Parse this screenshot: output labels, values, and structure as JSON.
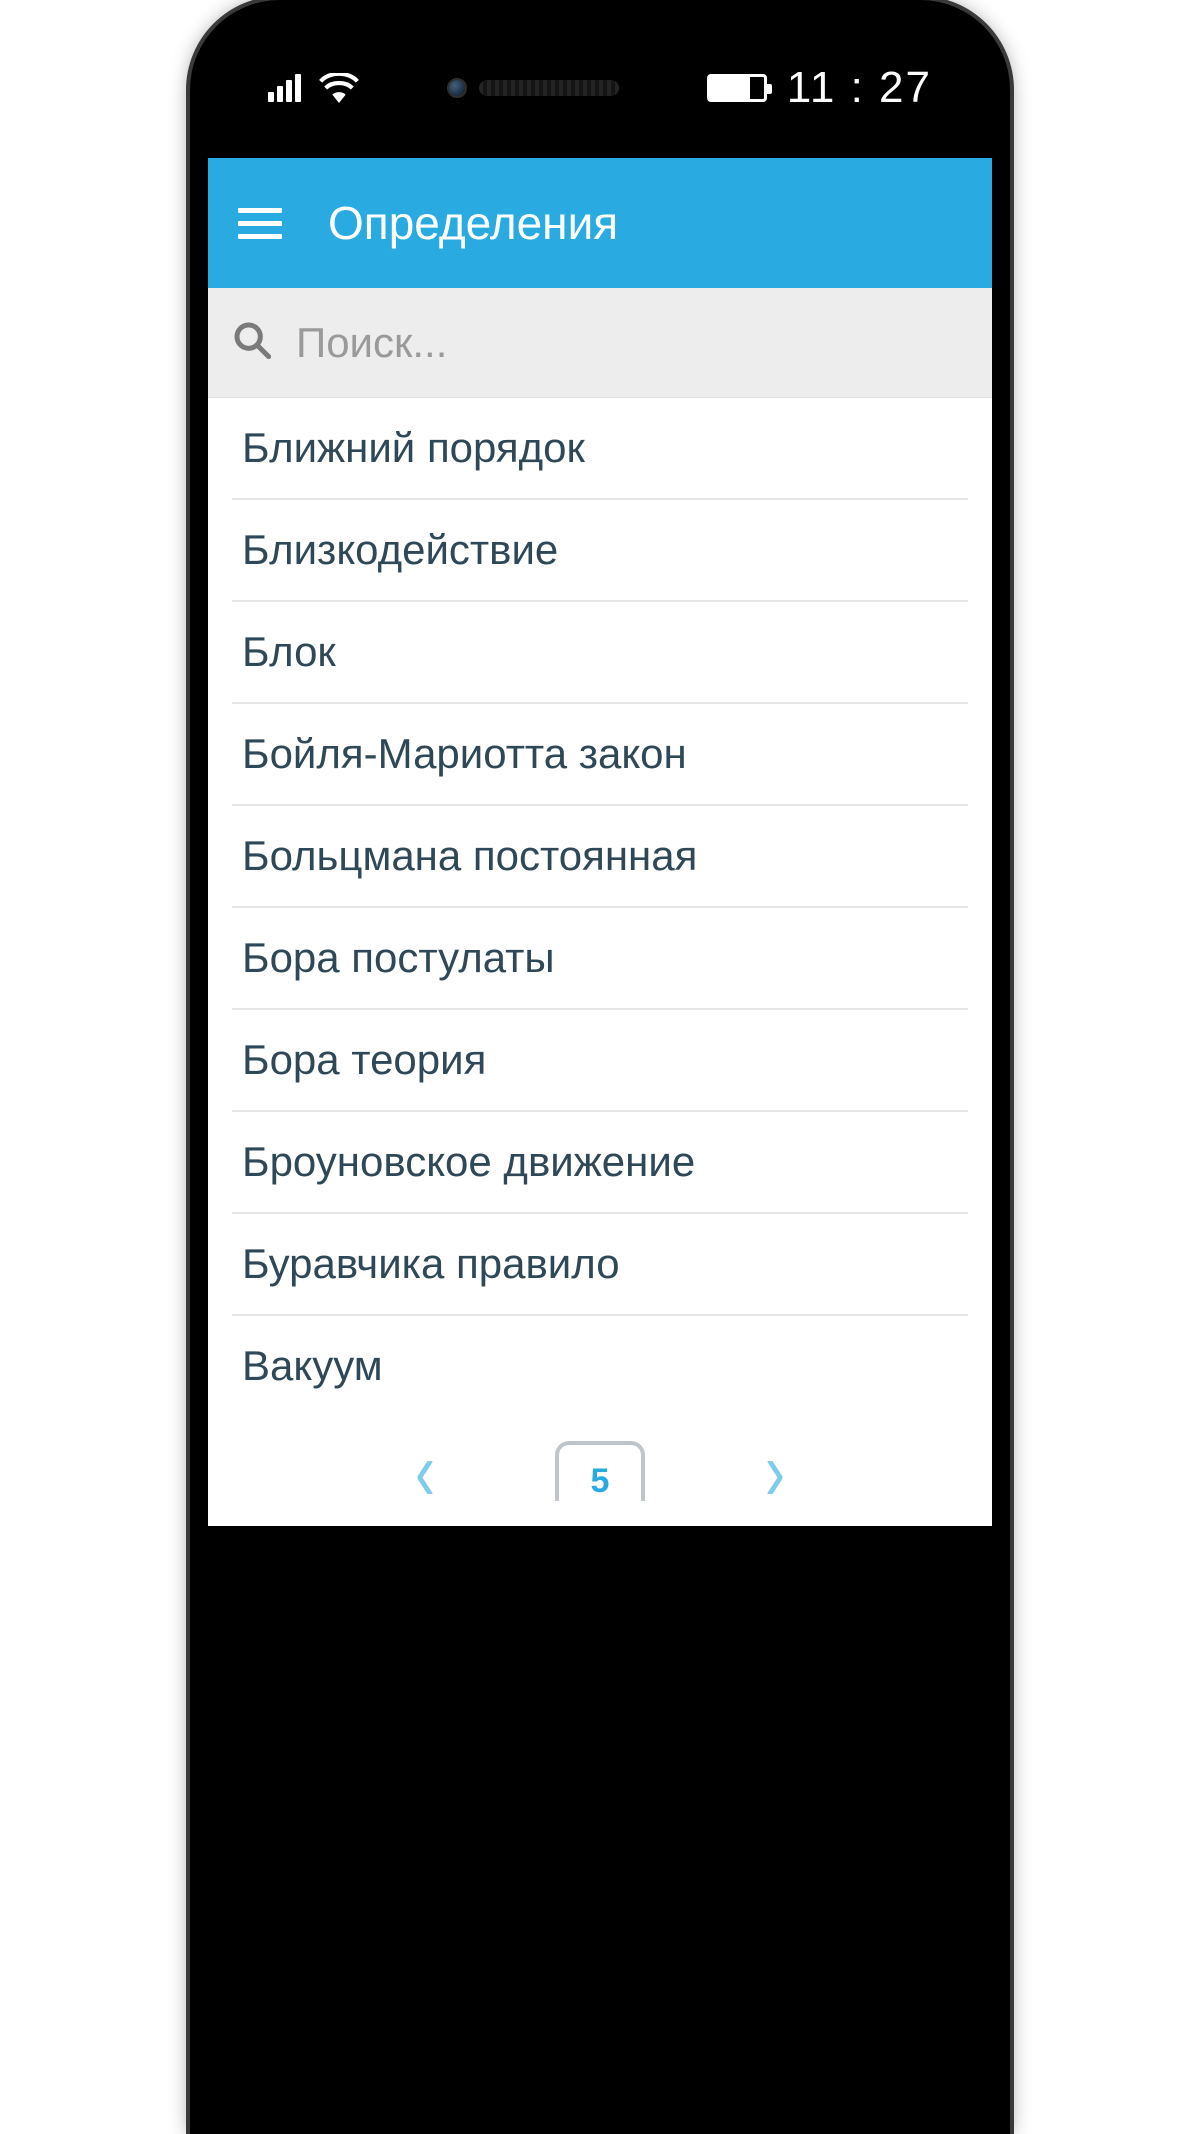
{
  "status": {
    "time": "11 : 27"
  },
  "header": {
    "title": "Определения"
  },
  "search": {
    "placeholder": "Поиск..."
  },
  "items": [
    "Ближний порядок",
    "Близкодействие",
    "Блок",
    "Бойля-Мариотта закон",
    "Больцмана постоянная",
    "Бора постулаты",
    "Бора теория",
    "Броуновское движение",
    "Буравчика правило",
    "Вакуум"
  ],
  "pagination": {
    "prev": "‹",
    "next": "›",
    "page": "5"
  }
}
